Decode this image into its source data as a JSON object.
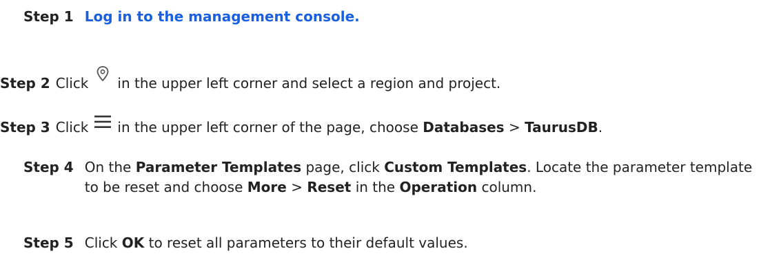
{
  "steps": [
    {
      "label": "Step 1",
      "link_text": "Log in to the management console."
    },
    {
      "label": "Step 2",
      "text_before_icon": "Click",
      "icon": "location-pin-icon",
      "text_after_icon": "in the upper left corner and select a region and project."
    },
    {
      "label": "Step 3",
      "text_before_icon": "Click",
      "icon": "hamburger-menu-icon",
      "text_after_icon": "in the upper left corner of the page, choose",
      "bold1": "Databases",
      "sep": ">",
      "bold2": "TaurusDB",
      "end": "."
    },
    {
      "label": "Step 4",
      "t1": "On the",
      "b1": "Parameter Templates",
      "t2": "page, click",
      "b2": "Custom Templates",
      "t3": ". Locate the parameter template to be reset and choose",
      "b3": "More",
      "t4": ">",
      "b4": "Reset",
      "t5": "in the",
      "b5": "Operation",
      "t6": "column."
    },
    {
      "label": "Step 5",
      "t1": "Click",
      "b1": "OK",
      "t2": "to reset all parameters to their default values."
    }
  ],
  "colors": {
    "link": "#1a5fe0",
    "text": "#222222",
    "icon": "#555555"
  }
}
